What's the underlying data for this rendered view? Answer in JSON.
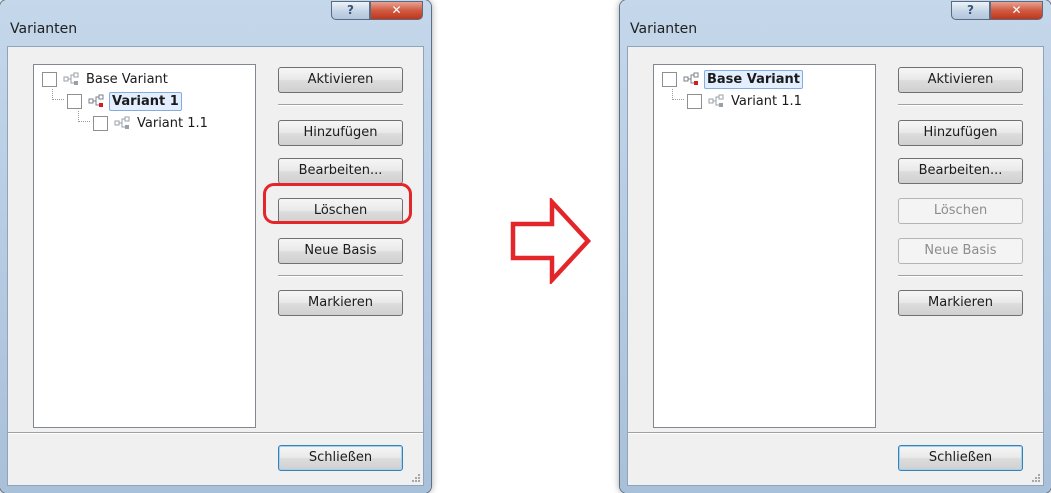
{
  "accent_colors": {
    "highlight": "#e3262a",
    "arrow": "#e3262a",
    "selection": "#e3efff"
  },
  "before": {
    "title": "Varianten",
    "help_label": "?",
    "close_label": "✕",
    "tree": [
      {
        "label": "Base Variant",
        "selected": false,
        "level": 0
      },
      {
        "label": "Variant 1",
        "selected": true,
        "level": 1
      },
      {
        "label": "Variant 1.1",
        "selected": false,
        "level": 2
      }
    ],
    "buttons": {
      "aktivieren": "Aktivieren",
      "hinzufuegen": "Hinzufügen",
      "bearbeiten": "Bearbeiten...",
      "loeschen": "Löschen",
      "neue_basis": "Neue Basis",
      "markieren": "Markieren",
      "schliessen": "Schließen"
    }
  },
  "after": {
    "title": "Varianten",
    "help_label": "?",
    "close_label": "✕",
    "tree": [
      {
        "label": "Base Variant",
        "selected": true,
        "level": 0
      },
      {
        "label": "Variant 1.1",
        "selected": false,
        "level": 1
      }
    ],
    "buttons": {
      "aktivieren": "Aktivieren",
      "hinzufuegen": "Hinzufügen",
      "bearbeiten": "Bearbeiten...",
      "loeschen": "Löschen",
      "neue_basis": "Neue Basis",
      "markieren": "Markieren",
      "schliessen": "Schließen"
    },
    "disabled": [
      "loeschen",
      "neue_basis"
    ]
  },
  "icons": {
    "variant": "variant-tree-icon",
    "arrow": "right-arrow-icon",
    "grip": "resize-grip-icon"
  }
}
